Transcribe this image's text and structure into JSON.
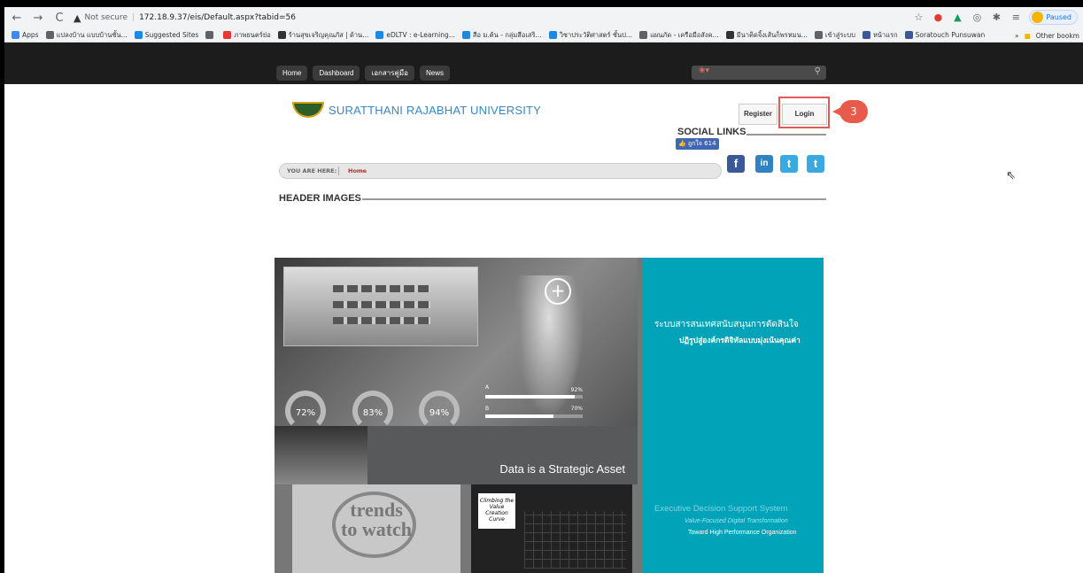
{
  "browser": {
    "nav": {
      "back": "←",
      "forward": "→",
      "reload": "C"
    },
    "security": "Not secure",
    "url": "172.18.9.37/eis/Default.aspx?tabid=56",
    "paused": "Paused",
    "bookmarks": [
      {
        "label": "Apps",
        "color": "#4285f4"
      },
      {
        "label": "แปลงบ้าน แบบบ้านชั้น...",
        "color": "#5f6368"
      },
      {
        "label": "Suggested Sites",
        "color": "#1e88e5"
      },
      {
        "label": "",
        "color": "#5f6368"
      },
      {
        "label": "ภาพยนตร์ย่อ",
        "color": "#e53935"
      },
      {
        "label": "ร้านสุขเจริญคุณภัส | ด้าน...",
        "color": "#333333"
      },
      {
        "label": "eDLTV : e-Learning...",
        "color": "#1e88e5"
      },
      {
        "label": "สือ ม.ต้น - กลุ่มสือเสริ...",
        "color": "#1e88e5"
      },
      {
        "label": "วิชาประวัติศาสตร์ ชั้นป...",
        "color": "#1e88e5"
      },
      {
        "label": "แผนภัด - เครือมือสังค...",
        "color": "#5f6368"
      },
      {
        "label": "มีนาคิดจิ้งเส้นก็พรหมน...",
        "color": "#333333"
      },
      {
        "label": "เข้าสู่ระบบ",
        "color": "#5f6368"
      },
      {
        "label": "หน้าแรก",
        "color": "#3b5998"
      },
      {
        "label": "Soratouch Punsuwan",
        "color": "#3b5998"
      }
    ],
    "more": "»",
    "other_bookmarks": "Other bookm"
  },
  "site": {
    "menu": [
      "Home",
      "Dashboard",
      "เอกสารคู่มือ",
      "News"
    ],
    "university": "SURATTHANI RAJABHAT UNIVERSITY",
    "register": "Register",
    "login": "Login",
    "step": "3",
    "social_title": "SOCIAL LINKS",
    "fb_like": "👍 ถูกใจ 614",
    "breadcrumb_label": "YOU ARE HERE:",
    "breadcrumb_value": "Home",
    "header_images": "HEADER IMAGES"
  },
  "banner": {
    "gauges": [
      "72%",
      "83%",
      "94%"
    ],
    "bars": [
      {
        "label": "A",
        "value": "92%",
        "fraction": 0.92
      },
      {
        "label": "B",
        "value": "70%",
        "fraction": 0.7
      }
    ],
    "data_text": "Data is a Strategic Asset",
    "trends_line1": "trends",
    "trends_line2": "to watch",
    "curve_note": "Climbing the Value Creation Curve",
    "thai_title": "ระบบสารสนเทศสนับสนุนการตัดสินใจ",
    "thai_sub": "ปฏิรูปสู่องค์กรดิจิทัลแบบมุ่งเน้นคุณค่า",
    "en_title": "Executive Decision Support System",
    "en_sub1": "Value-Focused Digital Transformation",
    "en_sub2": "Toward High Performance Organization"
  }
}
